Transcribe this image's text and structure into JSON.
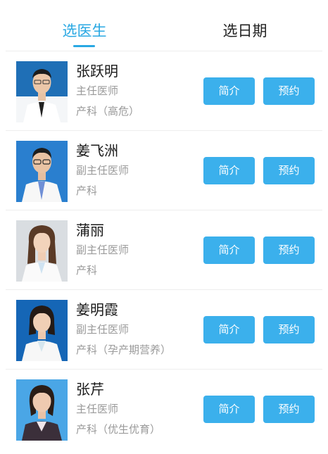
{
  "theme": {
    "accent": "#29a8e3",
    "button_bg": "#3bb0ec"
  },
  "tabs": [
    {
      "label": "选医生",
      "active": true
    },
    {
      "label": "选日期",
      "active": false
    }
  ],
  "doctors": [
    {
      "name": "张跃明",
      "title": "主任医师",
      "department": "产科（高危）",
      "photo": "doctor-photo-male-glasses",
      "intro_label": "简介",
      "book_label": "预约"
    },
    {
      "name": "姜飞洲",
      "title": "副主任医师",
      "department": "产科",
      "photo": "doctor-photo-male-glasses",
      "intro_label": "简介",
      "book_label": "预约"
    },
    {
      "name": "蒲丽",
      "title": "副主任医师",
      "department": "产科",
      "photo": "doctor-photo-female",
      "intro_label": "简介",
      "book_label": "预约"
    },
    {
      "name": "姜明霞",
      "title": "副主任医师",
      "department": "产科（孕产期营养）",
      "photo": "doctor-photo-female",
      "intro_label": "简介",
      "book_label": "预约"
    },
    {
      "name": "张芹",
      "title": "主任医师",
      "department": "产科（优生优育）",
      "photo": "doctor-photo-female",
      "intro_label": "简介",
      "book_label": "预约"
    }
  ]
}
